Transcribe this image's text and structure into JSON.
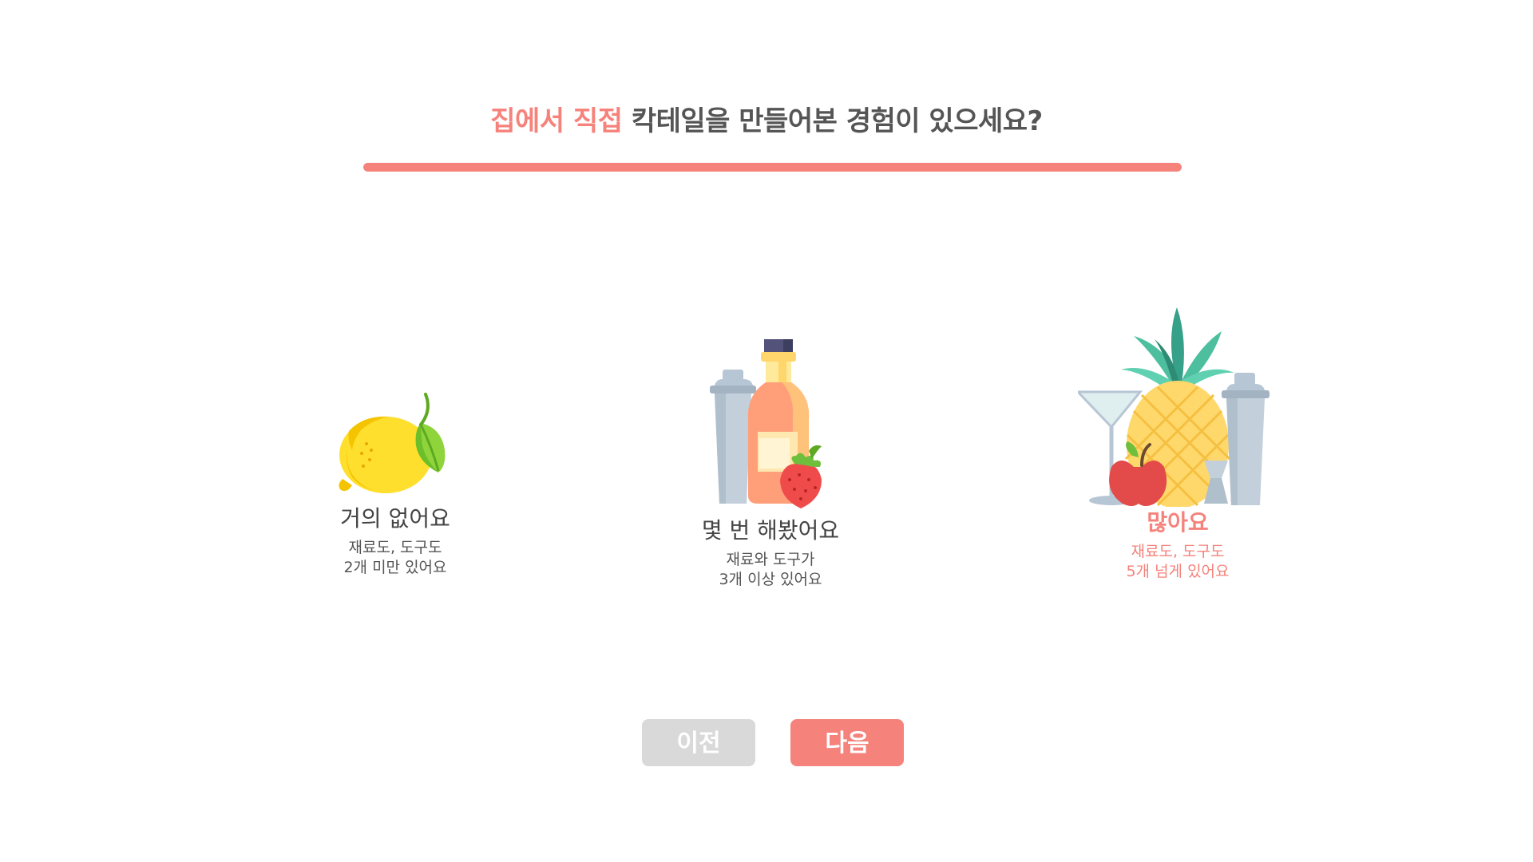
{
  "question": {
    "highlight": "집에서 직접",
    "rest": " 칵테일을 만들어본 경험이 있으세요?"
  },
  "progress": {
    "value": 1.0,
    "fill_color": "#f5827b"
  },
  "options": [
    {
      "title": "거의 없어요",
      "desc_line1": "재료도, 도구도",
      "desc_line2": "2개 미만 있어요",
      "icon": "lemon-icon",
      "selected": false
    },
    {
      "title": "몇 번 해봤어요",
      "desc_line1": "재료와 도구가",
      "desc_line2": "3개 이상 있어요",
      "icon": "bottle-shaker-strawberry-icon",
      "selected": false
    },
    {
      "title": "많아요",
      "desc_line1": "재료도, 도구도",
      "desc_line2": "5개 넘게 있어요",
      "icon": "pineapple-bar-set-icon",
      "selected": true
    }
  ],
  "buttons": {
    "prev_label": "이전",
    "next_label": "다음"
  },
  "colors": {
    "accent": "#f5827b",
    "text": "#555555",
    "disabled": "#d9d9d9"
  }
}
